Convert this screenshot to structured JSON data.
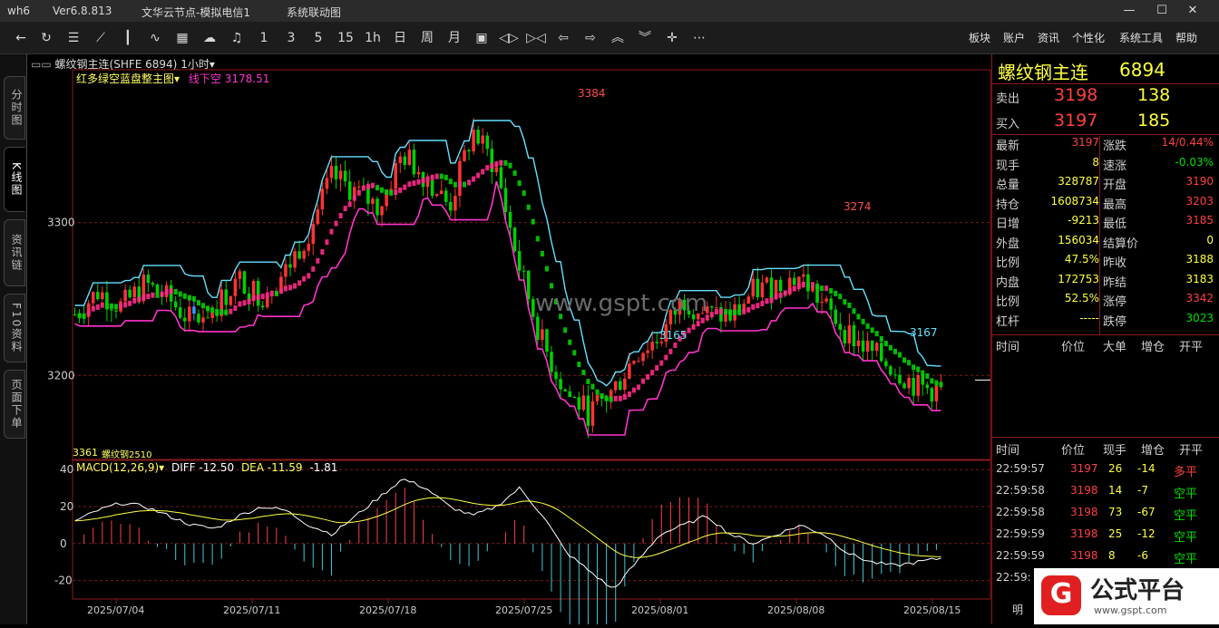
{
  "window": {
    "app": "wh6",
    "version": "Ver6.8.813",
    "server": "文华云节点-模拟电信1",
    "title": "系统联动图"
  },
  "toolbar": {
    "periods": [
      "1",
      "3",
      "5",
      "15",
      "1h",
      "日",
      "周",
      "月"
    ],
    "menus": [
      "板块",
      "账户",
      "资讯",
      "个性化",
      "系统工具",
      "帮助"
    ]
  },
  "left_tabs": [
    "分时图",
    "K线图",
    "资讯链",
    "F10资料",
    "页面下单"
  ],
  "chart_header": {
    "contract": "螺纹钢主连(SHFE 6894)",
    "period": "1小时",
    "indicator": "红多绿空蓝盘整主图",
    "lower_label": "线下空",
    "lower_value": "3178.51"
  },
  "macd_header": {
    "name": "MACD(12,26,9)",
    "diff_label": "DIFF",
    "diff": "-12.50",
    "dea_label": "DEA",
    "dea": "-11.59",
    "macd": "-1.81"
  },
  "watermark": "www.gspt.com",
  "bottom_left_label": "3361",
  "bottom_left_sub": "螺纹钢2510",
  "annotations": {
    "high1": "3384",
    "low1": "3165",
    "high2": "3274",
    "low2": "3167"
  },
  "colors": {
    "up": "#ff3333",
    "down": "#00d000",
    "consolidate": "#3399ff",
    "ma": "#ff2a8a",
    "support": "#ff33cc",
    "resist": "#66e0ff"
  },
  "quote": {
    "name": "螺纹钢主连",
    "code": "6894",
    "ask_label": "卖出",
    "ask_price": "3198",
    "ask_vol": "138",
    "bid_label": "买入",
    "bid_price": "3197",
    "bid_vol": "185",
    "left": [
      {
        "label": "最新",
        "value": "3197",
        "cls": "red"
      },
      {
        "label": "现手",
        "value": "8",
        "cls": "yellow"
      },
      {
        "label": "总量",
        "value": "328787",
        "cls": "yellow"
      },
      {
        "label": "持仓",
        "value": "1608734",
        "cls": "yellow"
      },
      {
        "label": "日增",
        "value": "-9213",
        "cls": "yellow"
      },
      {
        "label": "外盘",
        "value": "156034",
        "cls": "yellow"
      },
      {
        "label": "比例",
        "value": "47.5%",
        "cls": "yellow"
      },
      {
        "label": "内盘",
        "value": "172753",
        "cls": "yellow"
      },
      {
        "label": "比例",
        "value": "52.5%",
        "cls": "yellow"
      },
      {
        "label": "杠杆",
        "value": "-----",
        "cls": "yellow"
      }
    ],
    "right": [
      {
        "label": "涨跌",
        "value": "14/0.44%",
        "cls": "red"
      },
      {
        "label": "速涨",
        "value": "-0.03%",
        "cls": "green"
      },
      {
        "label": "开盘",
        "value": "3190",
        "cls": "red"
      },
      {
        "label": "最高",
        "value": "3203",
        "cls": "red"
      },
      {
        "label": "最低",
        "value": "3185",
        "cls": "red"
      },
      {
        "label": "结算价",
        "value": "0",
        "cls": "yellow"
      },
      {
        "label": "昨收",
        "value": "3188",
        "cls": "yellow"
      },
      {
        "label": "昨结",
        "value": "3183",
        "cls": "yellow"
      },
      {
        "label": "涨停",
        "value": "3342",
        "cls": "red"
      },
      {
        "label": "跌停",
        "value": "3023",
        "cls": "green"
      }
    ]
  },
  "tick_header1": [
    "时间",
    "价位",
    "大单",
    "增仓",
    "开平"
  ],
  "tick_header2": [
    "时间",
    "价位",
    "现手",
    "增仓",
    "开平"
  ],
  "ticks": [
    {
      "time": "22:59:57",
      "price": "3197",
      "vol": "26",
      "chg": "-14",
      "type": "多平"
    },
    {
      "time": "22:59:58",
      "price": "3198",
      "vol": "14",
      "chg": "-7",
      "type": "空平"
    },
    {
      "time": "22:59:58",
      "price": "3198",
      "vol": "73",
      "chg": "-67",
      "type": "空平"
    },
    {
      "time": "22:59:59",
      "price": "3198",
      "vol": "25",
      "chg": "-12",
      "type": "空平"
    },
    {
      "time": "22:59:59",
      "price": "3198",
      "vol": "8",
      "chg": "-6",
      "type": "空平"
    },
    {
      "time": "22:59:",
      "price": "",
      "vol": "",
      "chg": "",
      "type": ""
    }
  ],
  "bottom_tab": "明",
  "logo": "公式平台",
  "logo_url": "www.gspt.com",
  "chart_data": {
    "type": "candlestick",
    "y_axis": {
      "labels": [
        "3300",
        "3200"
      ],
      "values": [
        3300,
        3200
      ],
      "ylim": [
        3145,
        3400
      ]
    },
    "macd_axis": {
      "labels": [
        "40",
        "20",
        "0",
        "-20"
      ],
      "values": [
        40,
        20,
        0,
        -20
      ],
      "ylim": [
        -30,
        45
      ]
    },
    "x_axis": {
      "labels": [
        "2025/07/04",
        "2025/07/11",
        "2025/07/18",
        "2025/07/25",
        "2025/08/01",
        "2025/08/08",
        "2025/08/15"
      ]
    },
    "trend": [
      3240,
      3255,
      3245,
      3260,
      3250,
      3235,
      3245,
      3262,
      3252,
      3268,
      3295,
      3330,
      3320,
      3310,
      3345,
      3330,
      3310,
      3360,
      3335,
      3270,
      3220,
      3188,
      3175,
      3190,
      3215,
      3225,
      3250,
      3240,
      3238,
      3255,
      3260,
      3265,
      3245,
      3228,
      3215,
      3205,
      3192,
      3190
    ],
    "macd": [
      12,
      18,
      22,
      20,
      15,
      10,
      8,
      15,
      20,
      18,
      10,
      5,
      15,
      25,
      35,
      30,
      20,
      15,
      20,
      30,
      15,
      -5,
      -15,
      -25,
      -10,
      5,
      10,
      15,
      5,
      0,
      5,
      10,
      5,
      -5,
      -10,
      -12,
      -10,
      -8
    ]
  }
}
